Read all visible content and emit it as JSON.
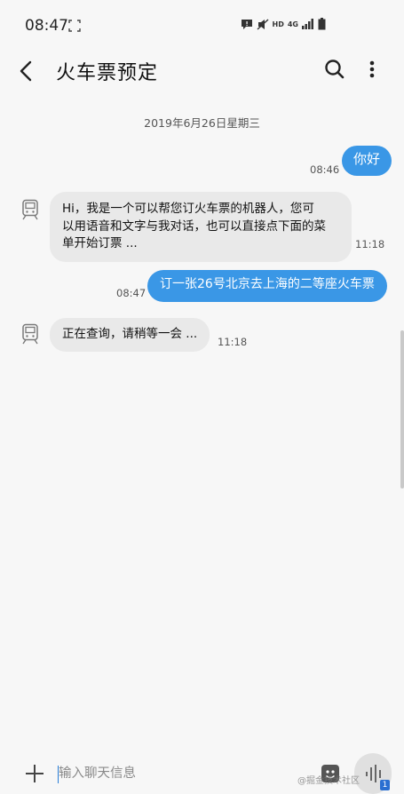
{
  "status_bar": {
    "time": "08:47",
    "network": "HD",
    "net_type": "4G"
  },
  "header": {
    "title": "火车票预定"
  },
  "conversation": {
    "date_separator": "2019年6月26日星期三",
    "messages": [
      {
        "direction": "outgoing",
        "text": "你好",
        "time": "08:46"
      },
      {
        "direction": "incoming",
        "lines": [
          "Hi，我是一个可以帮您订火车票的机器人，您可",
          "以用语音和文字与我对话，也可以直接点下面的菜",
          "单开始订票 ..."
        ],
        "time": "11:18"
      },
      {
        "direction": "outgoing",
        "text": "订一张26号北京去上海的二等座火车票",
        "time": "08:47"
      },
      {
        "direction": "incoming",
        "text": "正在查询，请稍等一会 ...",
        "time": "11:18"
      }
    ]
  },
  "composer": {
    "placeholder": "输入聊天信息",
    "sim_label": "1"
  },
  "watermark": "@掘金技术社区",
  "colors": {
    "outgoing_bubble": "#3a97e6",
    "incoming_bubble": "#e9e9e9",
    "background": "#f7f7f7"
  }
}
